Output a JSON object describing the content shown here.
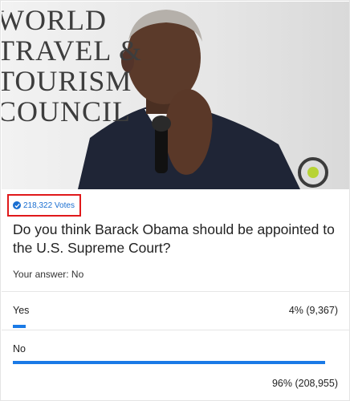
{
  "hero": {
    "wordmark_lines": [
      "WORLD",
      "TRAVEL &",
      "TOURISM",
      "COUNCIL"
    ]
  },
  "poll": {
    "votes_label": "218,322 Votes",
    "question": "Do you think Barack Obama should be appointed to the U.S. Supreme Court?",
    "your_answer": "Your answer: No",
    "options": [
      {
        "label": "Yes",
        "result": "4% (9,367)",
        "percent": 4
      },
      {
        "label": "No",
        "result": "96% (208,955)",
        "percent": 96
      }
    ],
    "accent_color": "#1a7ae6",
    "badge_border_color": "#e0191b"
  }
}
